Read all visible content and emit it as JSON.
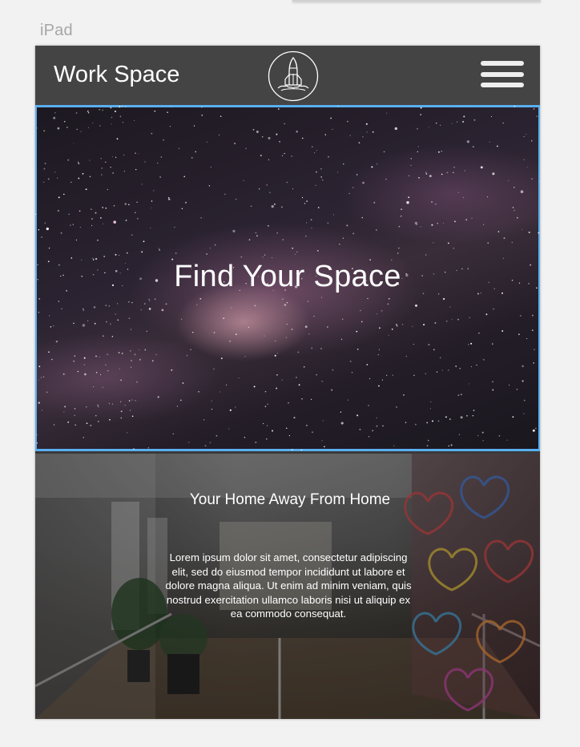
{
  "artboard": {
    "label": "iPad"
  },
  "nav": {
    "brand": "Work Space",
    "logo_icon": "rocket-launch-icon",
    "menu_icon": "hamburger-menu-icon"
  },
  "hero": {
    "title": "Find Your Space",
    "highlight_color": "#5aaef0"
  },
  "section2": {
    "title": "Your Home Away From Home",
    "body": "Lorem ipsum dolor sit amet, consectetur adipiscing elit, sed do eiusmod tempor incididunt ut labore et dolore magna aliqua. Ut enim ad minim veniam, quis nostrud exercitation ullamco laboris nisi ut aliquip ex ea commodo consequat."
  }
}
